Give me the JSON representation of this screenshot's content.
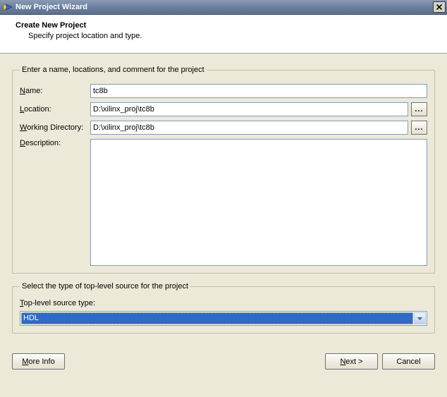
{
  "window": {
    "title": "New Project Wizard"
  },
  "header": {
    "heading": "Create New Project",
    "subheading": "Specify project location and type."
  },
  "group1": {
    "legend": "Enter a name, locations, and comment for the project",
    "name_label_pre": "N",
    "name_label_post": "ame:",
    "name_value": "tc8b",
    "location_label_pre": "L",
    "location_label_post": "ocation:",
    "location_value": "D:\\xilinx_proj\\tc8b",
    "wd_label_pre": "W",
    "wd_label_post": "orking Directory:",
    "wd_value": "D:\\xilinx_proj\\tc8b",
    "desc_label_pre": "D",
    "desc_label_post": "escription:",
    "desc_value": "",
    "browse_glyph": "..."
  },
  "group2": {
    "legend": "Select the type of top-level source for the project",
    "type_label_pre": "T",
    "type_label_post": "op-level source type:",
    "selected": "HDL"
  },
  "footer": {
    "more_info_pre": "M",
    "more_info_post": "ore Info",
    "next_pre": "N",
    "next_post": "ext >",
    "cancel": "Cancel"
  }
}
